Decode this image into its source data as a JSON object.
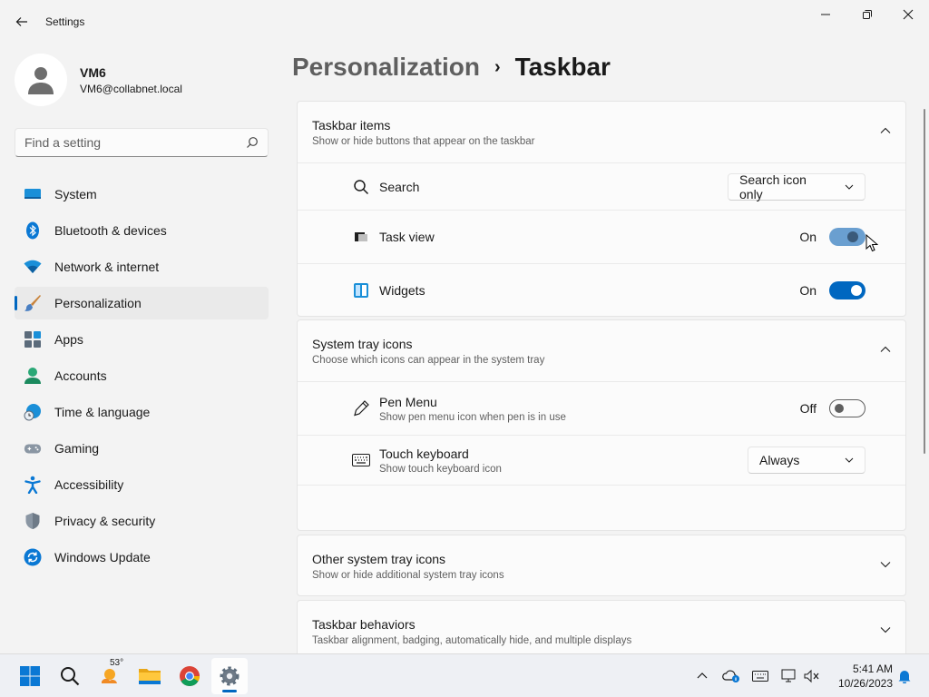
{
  "window": {
    "title": "Settings"
  },
  "profile": {
    "name": "VM6",
    "email": "VM6@collabnet.local"
  },
  "search": {
    "placeholder": "Find a setting"
  },
  "nav": [
    {
      "label": "System",
      "icon": "monitor-icon",
      "active": false
    },
    {
      "label": "Bluetooth & devices",
      "icon": "bluetooth-icon",
      "active": false
    },
    {
      "label": "Network & internet",
      "icon": "wifi-icon",
      "active": false
    },
    {
      "label": "Personalization",
      "icon": "brush-icon",
      "active": true
    },
    {
      "label": "Apps",
      "icon": "apps-icon",
      "active": false
    },
    {
      "label": "Accounts",
      "icon": "person-icon",
      "active": false
    },
    {
      "label": "Time & language",
      "icon": "globe-clock-icon",
      "active": false
    },
    {
      "label": "Gaming",
      "icon": "gamepad-icon",
      "active": false
    },
    {
      "label": "Accessibility",
      "icon": "accessibility-icon",
      "active": false
    },
    {
      "label": "Privacy & security",
      "icon": "shield-icon",
      "active": false
    },
    {
      "label": "Windows Update",
      "icon": "update-icon",
      "active": false
    }
  ],
  "header": {
    "parent": "Personalization",
    "separator": "›",
    "current": "Taskbar"
  },
  "taskbar_items": {
    "title": "Taskbar items",
    "desc": "Show or hide buttons that appear on the taskbar",
    "search": {
      "label": "Search",
      "value": "Search icon only"
    },
    "task_view": {
      "label": "Task view",
      "state": "On"
    },
    "widgets": {
      "label": "Widgets",
      "state": "On"
    }
  },
  "system_tray": {
    "title": "System tray icons",
    "desc": "Choose which icons can appear in the system tray",
    "pen_menu": {
      "label": "Pen Menu",
      "desc": "Show pen menu icon when pen is in use",
      "state": "Off"
    },
    "touch_keyboard": {
      "label": "Touch keyboard",
      "desc": "Show touch keyboard icon",
      "value": "Always"
    }
  },
  "other_tray": {
    "title": "Other system tray icons",
    "desc": "Show or hide additional system tray icons"
  },
  "behaviors": {
    "title": "Taskbar behaviors",
    "desc": "Taskbar alignment, badging, automatically hide, and multiple displays"
  },
  "taskbar": {
    "weather_temp": "53°",
    "time": "5:41 AM",
    "date": "10/26/2023"
  },
  "colors": {
    "accent": "#0067c0",
    "background": "#f3f3f3",
    "card": "#fbfbfb"
  }
}
